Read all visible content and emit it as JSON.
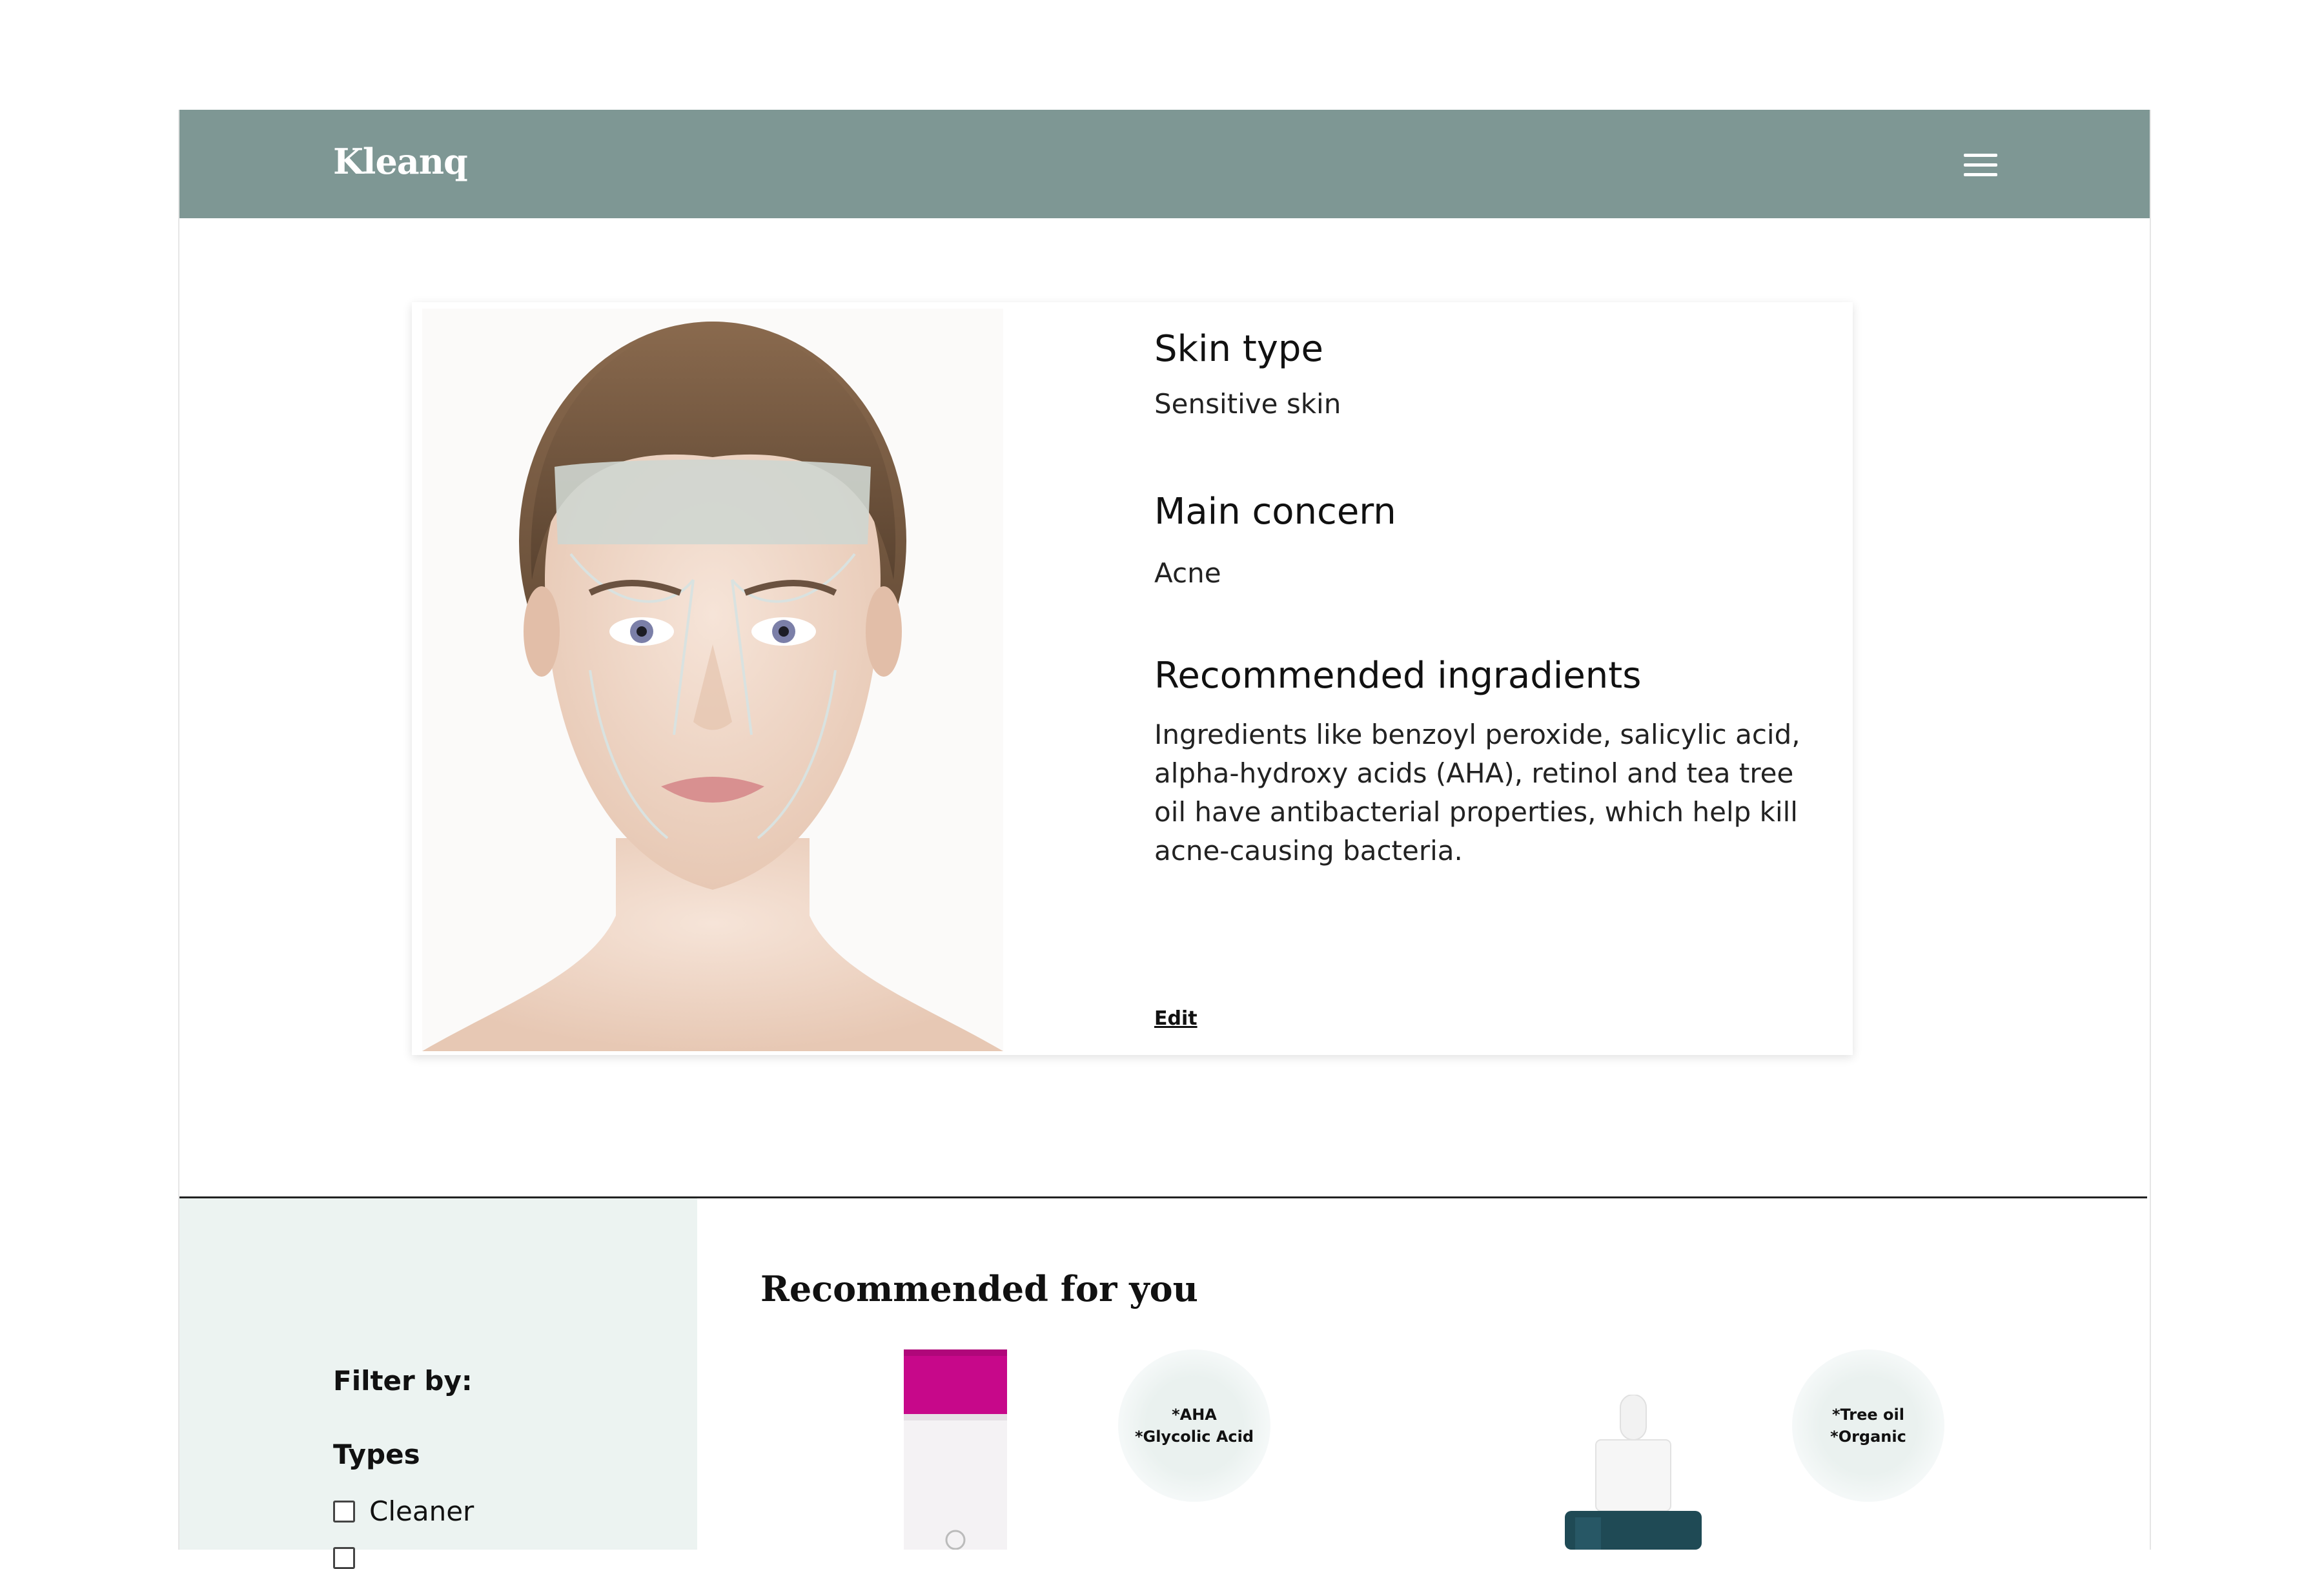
{
  "header": {
    "logo": "Kleanq"
  },
  "profile": {
    "skin_type_title": "Skin type",
    "skin_type_value": "Sensitive skin",
    "concern_title": "Main concern",
    "concern_value": "Acne",
    "ingredients_title": "Recommended ingradients",
    "ingredients_text": "Ingredients like benzoyl peroxide, salicylic acid, alpha-hydroxy acids (AHA), retinol and tea tree oil have antibacterial properties, which help kill acne-causing bacteria.",
    "edit_label": "Edit"
  },
  "filters": {
    "title": "Filter by:",
    "types_title": "Types",
    "options": [
      "Cleaner"
    ]
  },
  "recommended": {
    "title": "Recommended for you",
    "products": [
      {
        "tag_1": "*AHA",
        "tag_2": "*Glycolic Acid"
      },
      {
        "tag_1": "*Tree oil",
        "tag_2": "*Organic"
      }
    ]
  },
  "colors": {
    "navbar": "#7e9794",
    "sidebar": "#ecf3f1",
    "product_pink": "#c7088a",
    "product_teal": "#1f4a55"
  }
}
